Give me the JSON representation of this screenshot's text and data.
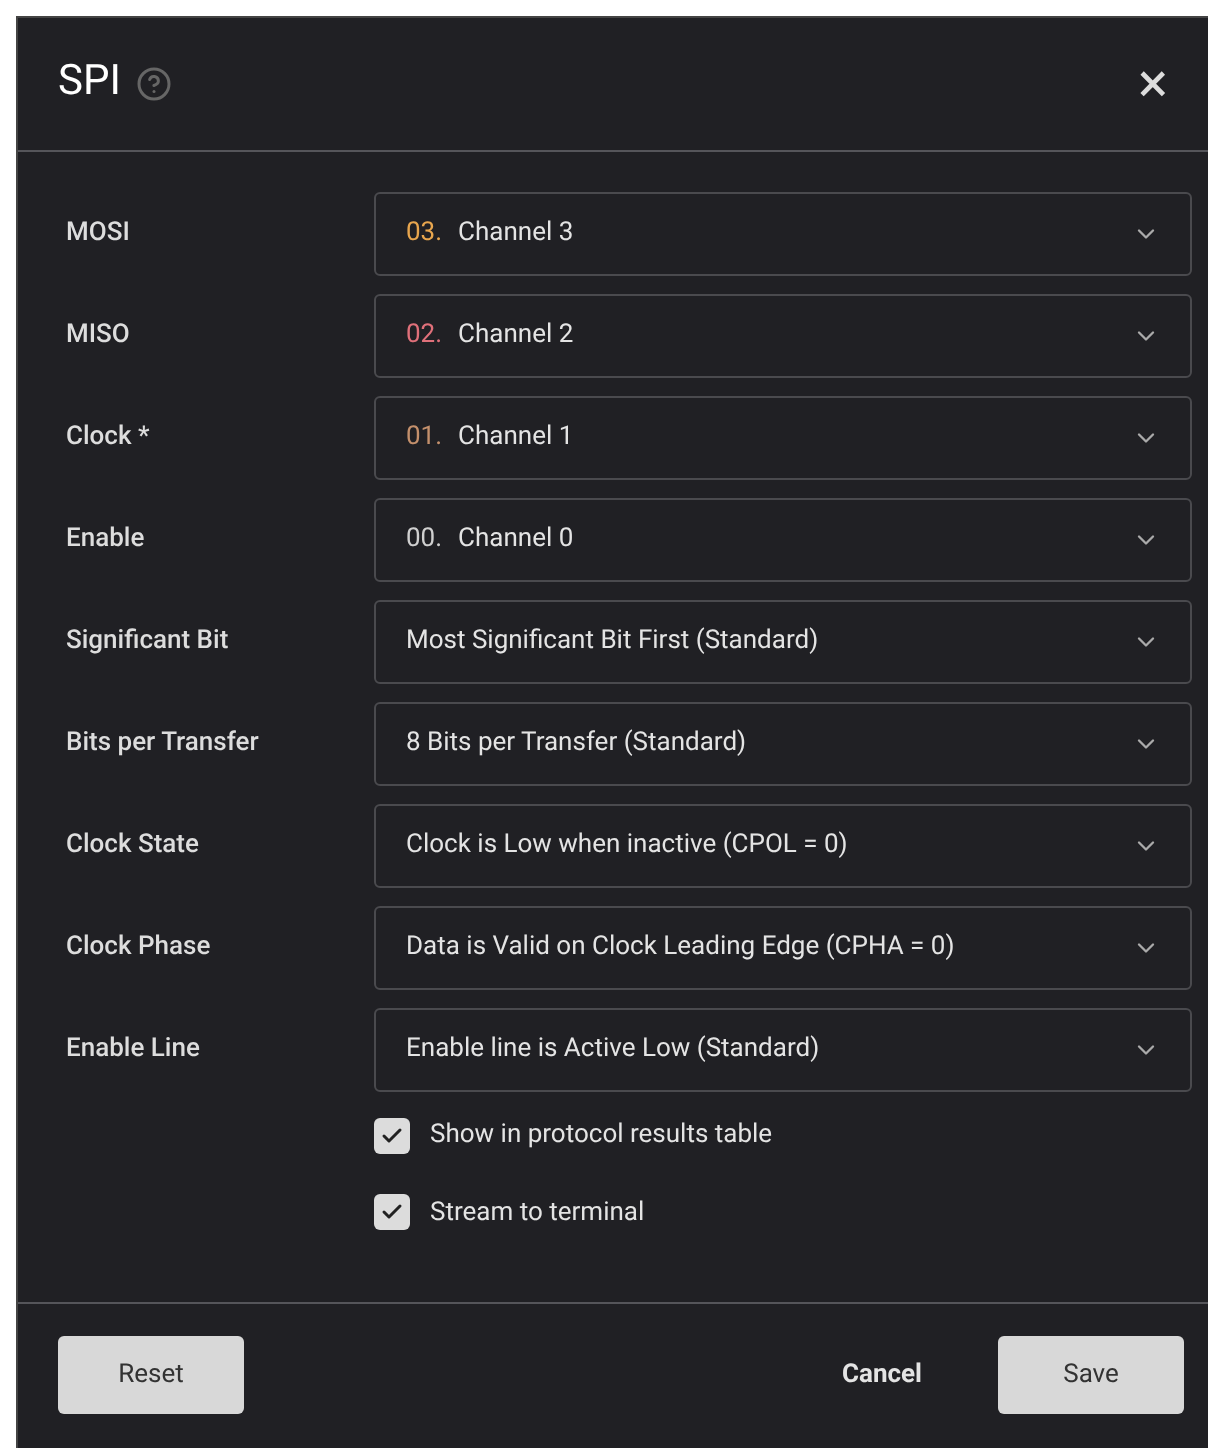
{
  "dialog": {
    "title": "SPI",
    "close": "×"
  },
  "fields": [
    {
      "label": "MOSI",
      "kind": "channel",
      "number": "03.",
      "value": "Channel 3",
      "color": "#e8a64e"
    },
    {
      "label": "MISO",
      "kind": "channel",
      "number": "02.",
      "value": "Channel 2",
      "color": "#e0707a"
    },
    {
      "label": "Clock *",
      "kind": "channel",
      "number": "01.",
      "value": "Channel 1",
      "color": "#c4906c"
    },
    {
      "label": "Enable",
      "kind": "channel",
      "number": "00.",
      "value": "Channel 0",
      "color": "#d0d0d0"
    },
    {
      "label": "Significant Bit",
      "kind": "option",
      "value": "Most Significant Bit First (Standard)"
    },
    {
      "label": "Bits per Transfer",
      "kind": "option",
      "value": "8 Bits per Transfer (Standard)"
    },
    {
      "label": "Clock State",
      "kind": "option",
      "value": "Clock is Low when inactive (CPOL = 0)"
    },
    {
      "label": "Clock Phase",
      "kind": "option",
      "value": "Data is Valid on Clock Leading Edge (CPHA = 0)"
    },
    {
      "label": "Enable Line",
      "kind": "option",
      "value": "Enable line is Active Low (Standard)"
    }
  ],
  "checkboxes": [
    {
      "label": "Show in protocol results table",
      "checked": true
    },
    {
      "label": "Stream to terminal",
      "checked": true
    }
  ],
  "buttons": {
    "reset": "Reset",
    "cancel": "Cancel",
    "save": "Save"
  }
}
